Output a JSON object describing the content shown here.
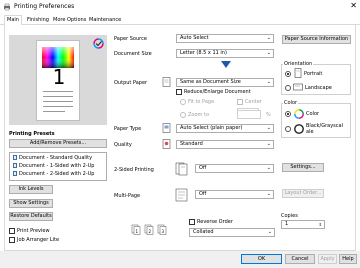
{
  "window": {
    "title": "Printing Preferences",
    "close_glyph": "✕"
  },
  "tabs": [
    {
      "label": "Main",
      "active": true
    },
    {
      "label": "Finishing"
    },
    {
      "label": "More Options"
    },
    {
      "label": "Maintenance"
    }
  ],
  "preview": {
    "page_number": "1"
  },
  "presets": {
    "heading": "Printing Presets",
    "add_remove_label": "Add/Remove Presets...",
    "items": [
      "Document - Standard Quality",
      "Document - 1-Sided with 2-Up",
      "Document - 2-Sided with 2-Up"
    ]
  },
  "left_buttons": {
    "ink_levels": "Ink Levels",
    "show_settings": "Show Settings",
    "restore_defaults": "Restore Defaults"
  },
  "left_checks": {
    "print_preview": "Print Preview",
    "job_arranger": "Job Arranger Lite"
  },
  "settings": {
    "paper_source": {
      "label": "Paper Source",
      "value": "Auto Select"
    },
    "paper_source_info": "Paper Source Information",
    "document_size": {
      "label": "Document Size",
      "value": "Letter (8.5 x 11 in)"
    },
    "output_paper": {
      "label": "Output Paper",
      "value": "Same as Document Size"
    },
    "reduce_enlarge": "Reduce/Enlarge Document",
    "fit_to_page": "Fit to Page",
    "zoom_to": "Zoom to",
    "center": "Center",
    "zoom_unit": "%",
    "paper_type": {
      "label": "Paper Type",
      "value": "Auto Select (plain paper)"
    },
    "quality": {
      "label": "Quality",
      "value": "Standard"
    },
    "two_sided": {
      "label": "2-Sided Printing",
      "value": "Off",
      "settings_button": "Settings..."
    },
    "multi_page": {
      "label": "Multi-Page",
      "value": "Off",
      "layout_button": "Layout Order..."
    },
    "reverse_order": "Reverse Order",
    "collated": {
      "value": "Collated"
    },
    "copies": {
      "label": "Copies",
      "value": "1"
    }
  },
  "orientation": {
    "title": "Orientation",
    "portrait": "Portrait",
    "landscape": "Landscape",
    "selected": "Portrait"
  },
  "color": {
    "title": "Color",
    "color": "Color",
    "grayscale_line1": "Black/Grayscal",
    "grayscale_line2": "ale",
    "selected": "Color"
  },
  "footer": {
    "ok": "OK",
    "cancel": "Cancel",
    "apply": "Apply",
    "help": "Help"
  },
  "accent": "#0078d7"
}
